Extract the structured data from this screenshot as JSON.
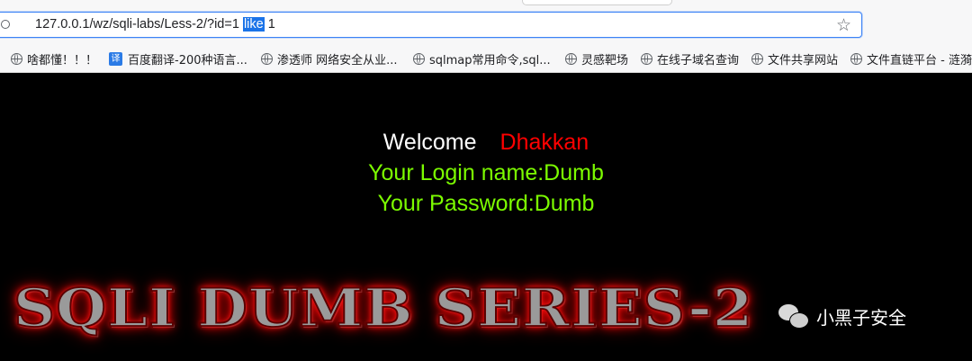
{
  "browser": {
    "url_before": "127.0.0.1/wz/sqli-labs/Less-2/?id=1 ",
    "url_selected": "like",
    "url_after": " 1",
    "bookmarks": [
      {
        "label": "啥都懂！！！",
        "icon": "globe-icon"
      },
      {
        "label": "百度翻译-200种语言...",
        "icon": "translate-icon",
        "icon_text": "译"
      },
      {
        "label": "渗透师 网络安全从业...",
        "icon": "globe-icon"
      },
      {
        "label": "sqlmap常用命令,sql...",
        "icon": "globe-icon"
      },
      {
        "label": "灵感靶场",
        "icon": "globe-icon"
      },
      {
        "label": "在线子域名查询",
        "icon": "globe-icon"
      },
      {
        "label": "文件共享网站",
        "icon": "globe-icon"
      },
      {
        "label": "文件直链平台 - 涟漪",
        "icon": "globe-icon"
      }
    ]
  },
  "page": {
    "welcome": "Welcome",
    "user": "Dhakkan",
    "login_name": "Your Login name:Dumb",
    "password": "Your Password:Dumb",
    "banner": "SQLI DUMB SERIES-2",
    "watermark": "小黑子安全"
  },
  "colors": {
    "welcome": "#ffffff",
    "user": "#ff0000",
    "info": "#7cfc00",
    "background": "#000000",
    "selection": "#1a73e8"
  }
}
